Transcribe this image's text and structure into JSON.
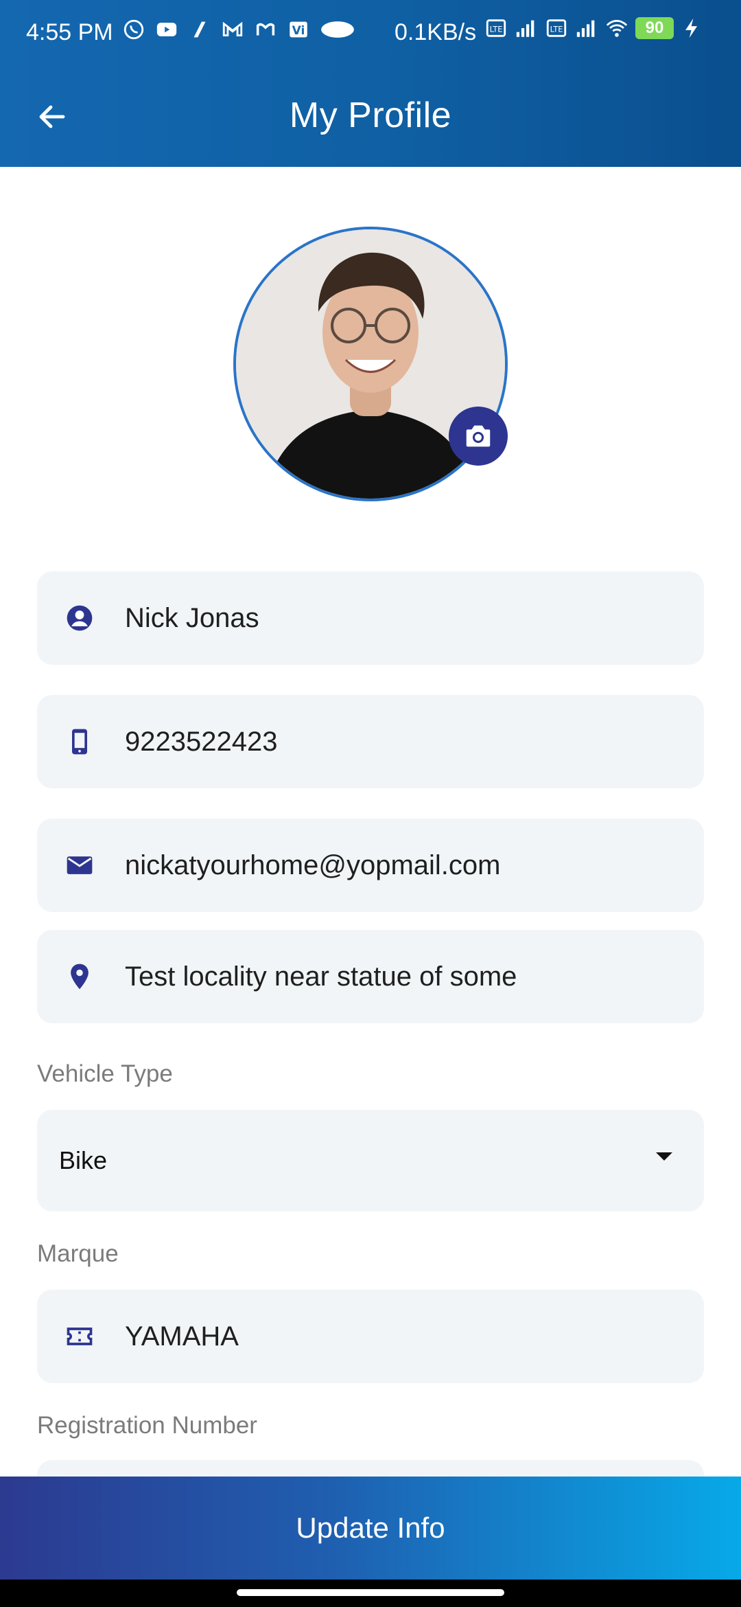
{
  "status_bar": {
    "time": "4:55 PM",
    "network_speed": "0.1KB/s",
    "battery_level": "90",
    "left_icons": [
      "whatsapp-icon",
      "youtube-icon",
      "app-icon",
      "gmail-icon",
      "m-app-icon",
      "vi-icon",
      "chat-bubble-icon"
    ],
    "right_icons": [
      "volte-icon",
      "signal-icon",
      "volte-icon",
      "signal-icon",
      "wifi-icon",
      "battery-icon",
      "charging-icon"
    ]
  },
  "app_bar": {
    "title": "My Profile",
    "back_icon": "arrow-left-icon"
  },
  "profile": {
    "avatar_alt": "profile photo",
    "camera_icon": "camera-icon"
  },
  "fields": {
    "name": "Nick Jonas",
    "phone": "9223522423",
    "email": "nickatyourhome@yopmail.com",
    "address": "Test locality near statue of some"
  },
  "vehicle": {
    "type_label": "Vehicle Type",
    "type_value": "Bike",
    "marque_label": "Marque",
    "marque_value": "YAMAHA",
    "registration_label": "Registration Number"
  },
  "actions": {
    "update_label": "Update Info"
  },
  "colors": {
    "header": "#1468b0",
    "accent": "#2d3590",
    "field_bg": "#f1f5f7",
    "button_start": "#2c3a90",
    "button_end": "#07a9e8"
  }
}
